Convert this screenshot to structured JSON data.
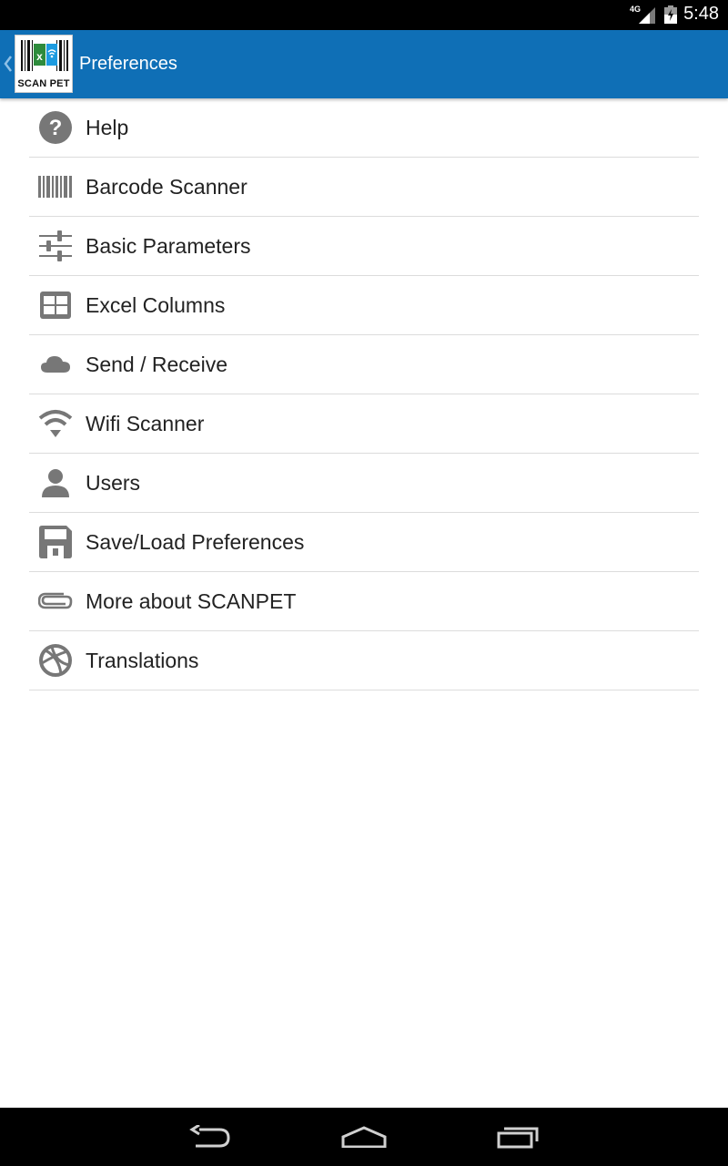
{
  "status_bar": {
    "network": "4G",
    "time": "5:48"
  },
  "action_bar": {
    "logo_text": "SCAN PET",
    "title": "Preferences",
    "color": "#0f6fb6"
  },
  "items": [
    {
      "label": "Help",
      "icon": "help-icon"
    },
    {
      "label": "Barcode Scanner",
      "icon": "barcode-icon"
    },
    {
      "label": "Basic Parameters",
      "icon": "sliders-icon"
    },
    {
      "label": "Excel Columns",
      "icon": "table-icon"
    },
    {
      "label": "Send / Receive",
      "icon": "cloud-icon"
    },
    {
      "label": "Wifi Scanner",
      "icon": "wifi-icon"
    },
    {
      "label": "Users",
      "icon": "user-icon"
    },
    {
      "label": "Save/Load Preferences",
      "icon": "floppy-disk-icon"
    },
    {
      "label": "More about SCANPET",
      "icon": "paperclip-icon"
    },
    {
      "label": "Translations",
      "icon": "globe-ball-icon"
    }
  ],
  "nav": {
    "back": "back-icon",
    "home": "home-icon",
    "recents": "recents-icon"
  }
}
